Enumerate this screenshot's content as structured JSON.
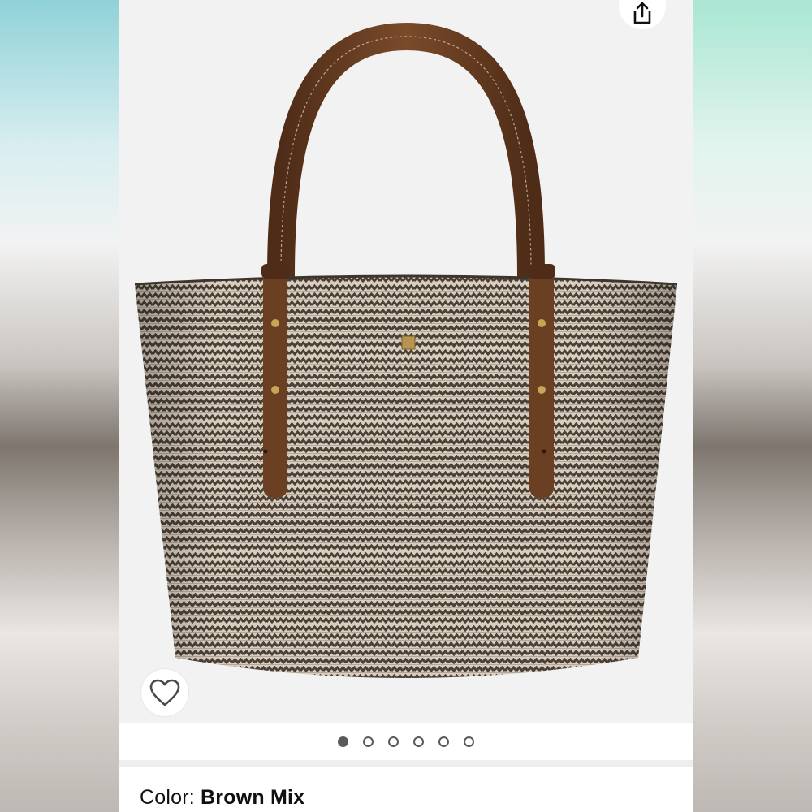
{
  "product": {
    "color_label": "Color: ",
    "color_value": "Brown Mix"
  },
  "gallery": {
    "total_images": 6,
    "active_index": 0
  },
  "icons": {
    "share": "share-icon",
    "wishlist": "heart-icon"
  },
  "colors": {
    "accent_dot": "#5a5a5a",
    "strap": "#6b3f22",
    "weave_dark": "#4a4038",
    "weave_light": "#d9cdbd"
  }
}
